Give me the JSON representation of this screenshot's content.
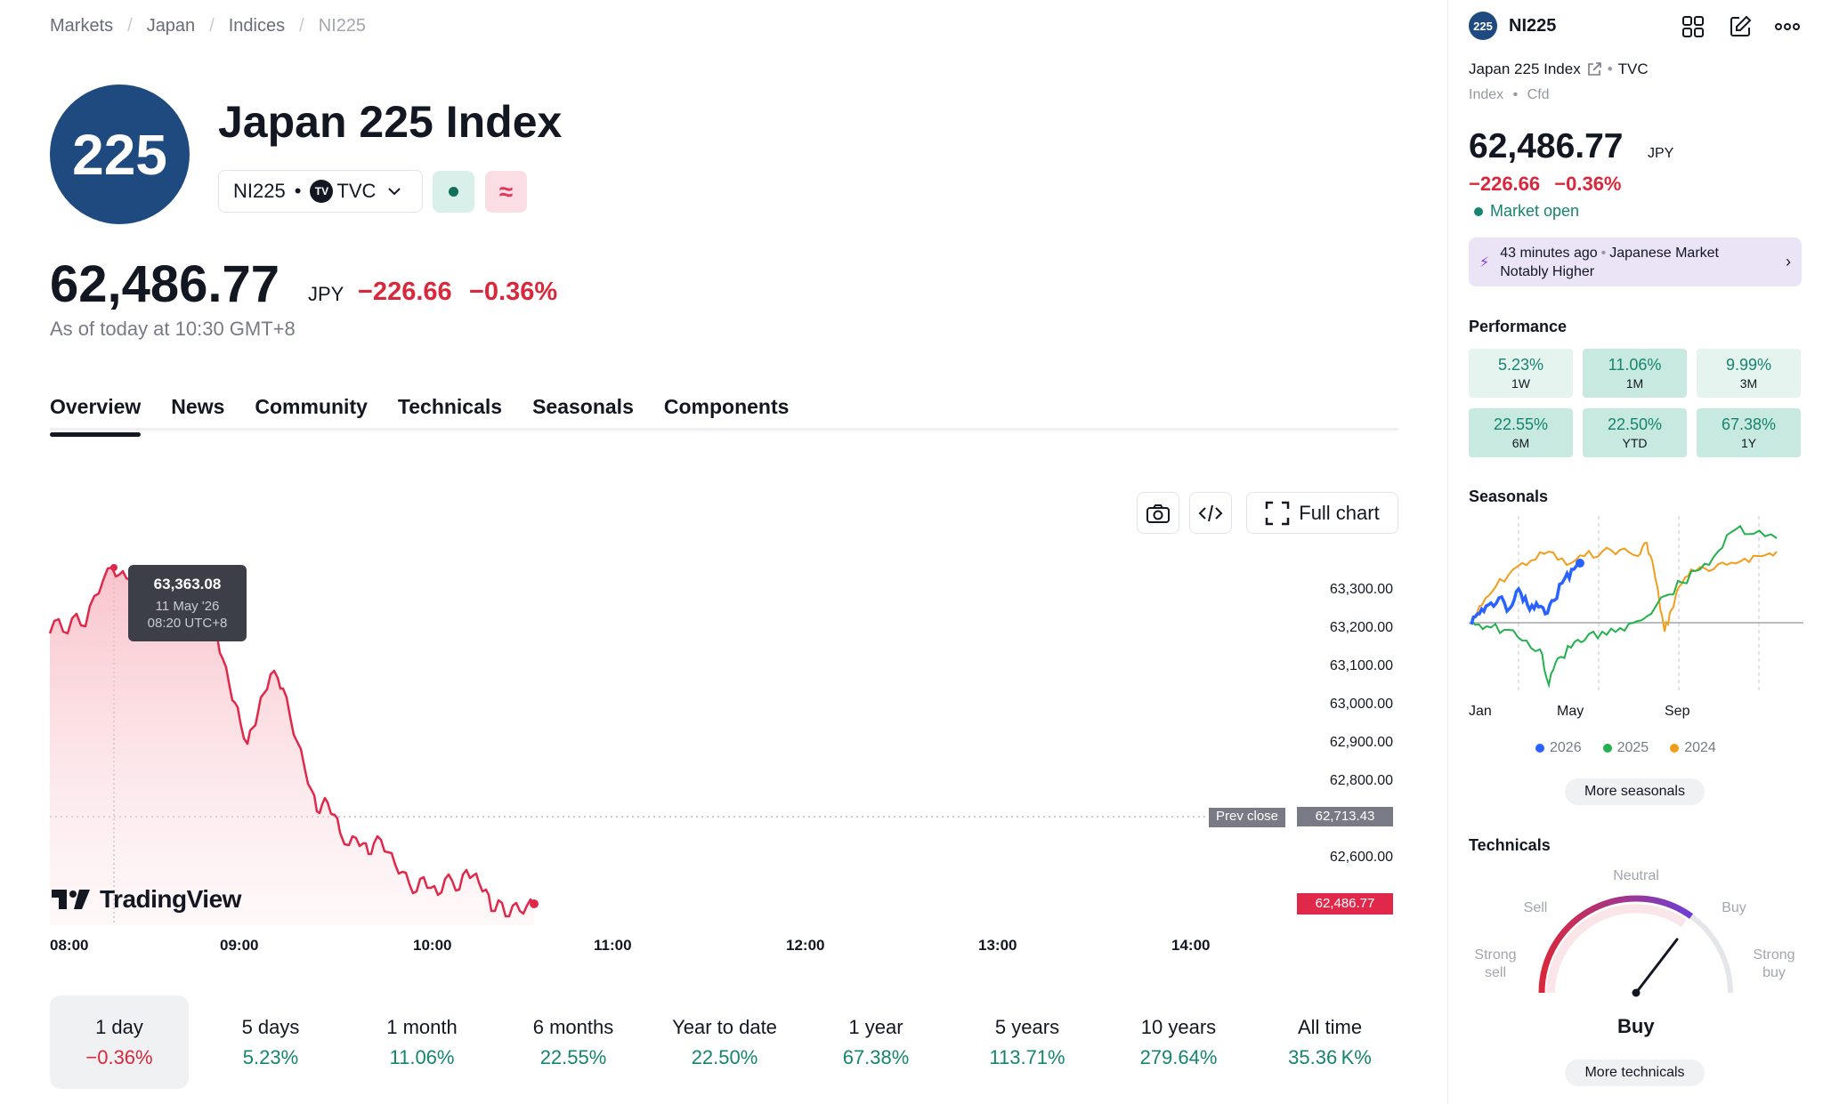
{
  "breadcrumb": [
    "Markets",
    "Japan",
    "Indices",
    "NI225"
  ],
  "header": {
    "logo_text": "225",
    "title": "Japan 225 Index",
    "symbol": "NI225",
    "exchange_glyph": "TV",
    "exchange": "TVC",
    "price": "62,486.77",
    "currency": "JPY",
    "change": "−226.66",
    "change_pct": "−0.36%",
    "as_of": "As of today at 10:30 GMT+8"
  },
  "tabs": [
    "Overview",
    "News",
    "Community",
    "Technicals",
    "Seasonals",
    "Components"
  ],
  "toolbar": {
    "full_chart_label": "Full chart"
  },
  "chart_data": {
    "type": "area",
    "x_ticks": [
      "08:00",
      "09:00",
      "10:00",
      "11:00",
      "12:00",
      "13:00",
      "14:00"
    ],
    "y_ticks": [
      "63,300.00",
      "63,200.00",
      "63,100.00",
      "63,000.00",
      "62,900.00",
      "62,800.00",
      "62,600.00"
    ],
    "prev_close_label": "Prev close",
    "prev_close": "62,713.43",
    "last_value": "62,486.77",
    "tooltip": {
      "value": "63,363.08",
      "date": "11 May '26",
      "time": "08:20 UTC+8"
    },
    "colors": {
      "line": "#e0294a",
      "fill": "#f7c6cc"
    },
    "brand": "TradingView"
  },
  "periods": [
    {
      "label": "1 day",
      "value": "−0.36%",
      "negative": true
    },
    {
      "label": "5 days",
      "value": "5.23%"
    },
    {
      "label": "1 month",
      "value": "11.06%"
    },
    {
      "label": "6 months",
      "value": "22.55%"
    },
    {
      "label": "Year to date",
      "value": "22.50%"
    },
    {
      "label": "1 year",
      "value": "67.38%"
    },
    {
      "label": "5 years",
      "value": "113.71%"
    },
    {
      "label": "10 years",
      "value": "279.64%"
    },
    {
      "label": "All time",
      "value": "35.36 K%"
    }
  ],
  "side": {
    "logo_text": "225",
    "symbol": "NI225",
    "name": "Japan 225 Index",
    "exchange": "TVC",
    "type": "Index",
    "subtype": "Cfd",
    "price": "62,486.77",
    "currency": "JPY",
    "change": "−226.66",
    "change_pct": "−0.36%",
    "market_status": "Market open",
    "news": {
      "time": "43 minutes ago",
      "line1": "Japanese Market",
      "line2": "Notably Higher"
    },
    "performance_title": "Performance",
    "performance": [
      {
        "value": "5.23%",
        "label": "1W",
        "bg": "#e6f4f0"
      },
      {
        "value": "11.06%",
        "label": "1M",
        "bg": "#c8e9df"
      },
      {
        "value": "9.99%",
        "label": "3M",
        "bg": "#e6f4f0"
      },
      {
        "value": "22.55%",
        "label": "6M",
        "bg": "#c8e9df"
      },
      {
        "value": "22.50%",
        "label": "YTD",
        "bg": "#c8e9df"
      },
      {
        "value": "67.38%",
        "label": "1Y",
        "bg": "#c8e9df"
      }
    ],
    "seasonals_title": "Seasonals",
    "seasonals_x": [
      "Jan",
      "May",
      "Sep"
    ],
    "seasonals_legend": [
      {
        "name": "2026",
        "color": "#2962ff"
      },
      {
        "name": "2025",
        "color": "#22b14c"
      },
      {
        "name": "2024",
        "color": "#f29d1a"
      }
    ],
    "more_seasonals": "More seasonals",
    "technicals_title": "Technicals",
    "gauge": {
      "neutral": "Neutral",
      "sell": "Sell",
      "buy": "Buy",
      "strong_sell_1": "Strong",
      "strong_sell_2": "sell",
      "strong_buy_1": "Strong",
      "strong_buy_2": "buy",
      "result": "Buy"
    },
    "more_technicals": "More technicals"
  }
}
